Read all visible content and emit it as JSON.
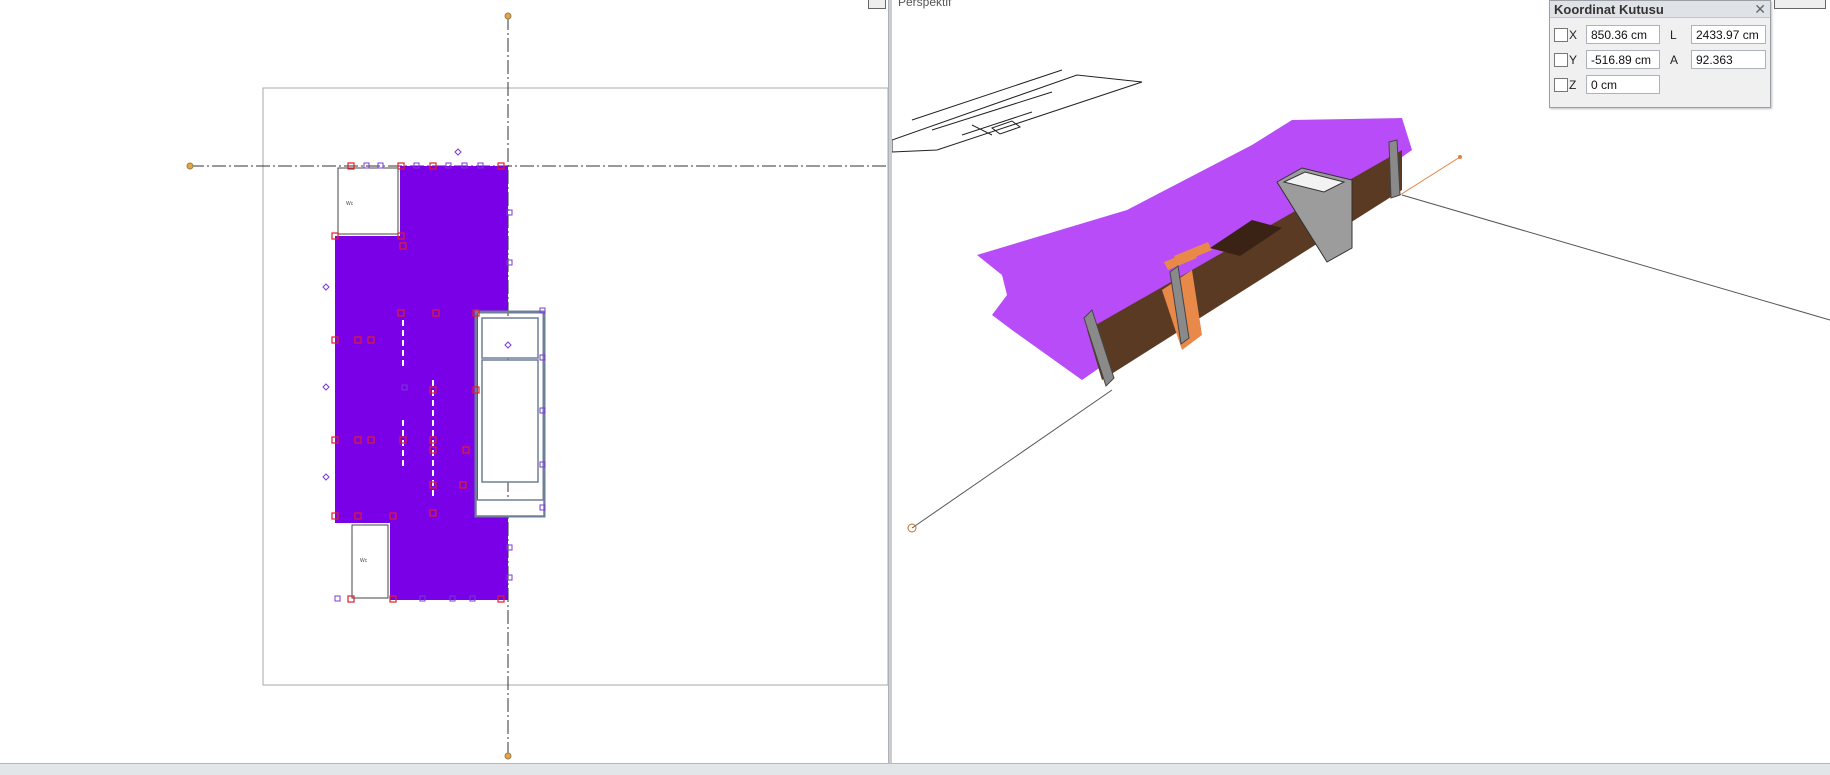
{
  "viewports": {
    "perspective_label": "Perspektif"
  },
  "coord_box": {
    "title": "Koordinat Kutusu",
    "close_icon": "close-icon",
    "x_label": "X",
    "x_value": "850.36 cm",
    "y_label": "Y",
    "y_value": "-516.89 cm",
    "z_label": "Z",
    "z_value": "0 cm",
    "l_label": "L",
    "l_value": "2433.97 cm",
    "a_label": "A",
    "a_value": "92.363"
  },
  "colors": {
    "slab_plan": "#7a00e8",
    "slab_3d": "#b84cf8",
    "wall_brown": "#5a3a22",
    "wall_orange": "#e8894a",
    "selection_red": "#e0202a"
  }
}
